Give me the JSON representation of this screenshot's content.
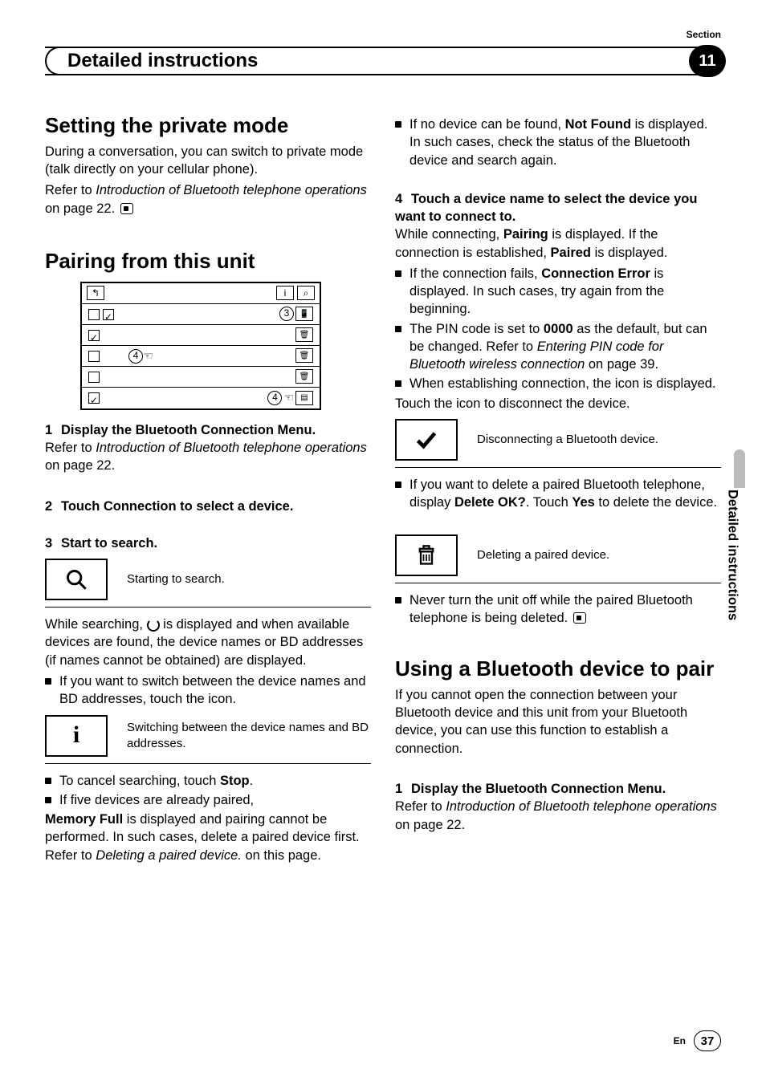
{
  "header": {
    "section_label": "Section",
    "chapter_title": "Detailed instructions",
    "chapter_number": "11"
  },
  "side_tab": "Detailed instructions",
  "footer": {
    "lang": "En",
    "page": "37"
  },
  "left": {
    "h_private": "Setting the private mode",
    "private_p1": "During a conversation, you can switch to private mode (talk directly on your cellular phone).",
    "private_p2a": "Refer to ",
    "private_p2_ital": "Introduction of Bluetooth telephone operations",
    "private_p2b": " on page 22.",
    "h_pairing": "Pairing from this unit",
    "step1": "Display the Bluetooth Connection Menu.",
    "step1_ref_a": "Refer to ",
    "step1_ref_ital": "Introduction of Bluetooth telephone operations",
    "step1_ref_b": " on page 22.",
    "step2": "Touch Connection to select a device.",
    "step3": "Start to search.",
    "search_caption": "Starting to search.",
    "while_search_a": "While searching, ",
    "while_search_b": " is displayed and when available devices are found, the device names or BD addresses (if names cannot be obtained) are displayed.",
    "switch_bullet": "If you want to switch between the device names and BD addresses, touch the icon.",
    "switch_caption": "Switching between the device names and BD addresses.",
    "cancel_a": "To cancel searching, touch ",
    "cancel_b": "Stop",
    "cancel_c": ".",
    "memfull_lead": "If five devices are already paired,",
    "memfull_a": "Memory Full",
    "memfull_b": " is displayed and pairing cannot be performed. In such cases, delete a paired device first. Refer to ",
    "memfull_ital": "Deleting a paired device.",
    "memfull_c": " on this page."
  },
  "right": {
    "notfound_lead": "If no device can be found, ",
    "notfound_bold": "Not Found",
    "notfound_b": " is displayed. In such cases, check the status of the Bluetooth device and search again.",
    "step4": "Touch a device name to select the device you want to connect to.",
    "pairing_a": "While connecting, ",
    "pairing_b1": "Pairing",
    "pairing_c": " is displayed. If the connection is established, ",
    "pairing_b2": "Paired",
    "pairing_d": " is displayed.",
    "connerr_lead": "If the connection fails, ",
    "connerr_bold": "Connection Error",
    "connerr_b": " is displayed. In such cases, try again from the beginning.",
    "pin_a": "The PIN code is set to ",
    "pin_bold": "0000",
    "pin_b": " as the default, but can be changed. Refer to ",
    "pin_ital": "Entering PIN code for Bluetooth wireless connection",
    "pin_c": " on page 39.",
    "establish": "When establishing connection, the icon is displayed.",
    "touch_disc": "Touch the icon to disconnect the device.",
    "disc_caption": "Disconnecting a Bluetooth device.",
    "delete_a": "If you want to delete a paired Bluetooth telephone, display ",
    "delete_b1": "Delete OK?",
    "delete_c": ". Touch ",
    "delete_b2": "Yes",
    "delete_d": " to delete the device.",
    "del_caption": "Deleting a paired device.",
    "never_off": "Never turn the unit off while the paired Bluetooth telephone is being deleted.",
    "h_using": "Using a Bluetooth device to pair",
    "using_p": "If you cannot open the connection between your Bluetooth device and this unit from your Bluetooth device, you can use this function to establish a connection.",
    "using_step1": "Display the Bluetooth Connection Menu.",
    "using_ref_a": "Refer to ",
    "using_ref_ital": "Introduction of Bluetooth telephone operations",
    "using_ref_b": " on page 22."
  },
  "fig": {
    "c3": "3",
    "c4": "4"
  }
}
